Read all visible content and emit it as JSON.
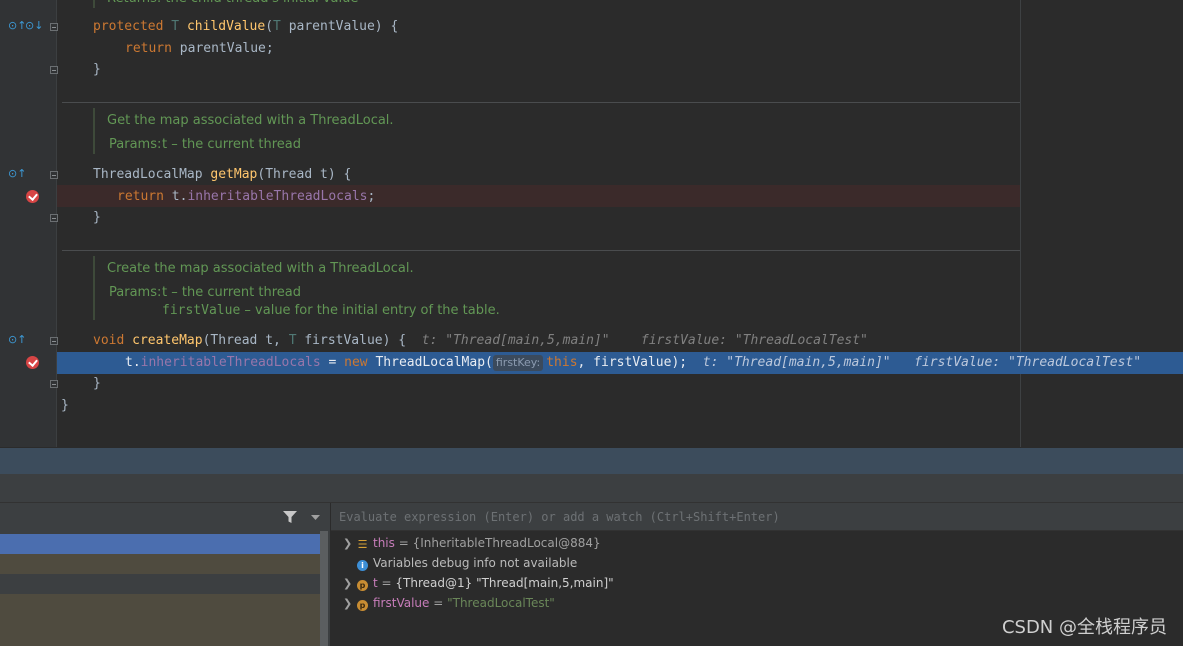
{
  "editor": {
    "line_prev_doc": "Returns: the child thread's initial value",
    "child_value_sig": {
      "kw": "protected",
      "tp1": "T",
      "name": "childValue",
      "rest": "(",
      "tp2": "T",
      "param": " parentValue) {"
    },
    "child_value_body": {
      "kw": "return",
      "rest": " parentValue;"
    },
    "close_brace": "}",
    "getmap_doc_line1": "Get the map associated with a ThreadLocal.",
    "getmap_doc_params": "Params:",
    "getmap_doc_param_t": "t – the current thread",
    "getmap_sig": {
      "type": "ThreadLocalMap ",
      "name": "getMap",
      "rest": "(Thread t) {"
    },
    "getmap_body": {
      "kw": "return",
      "obj": " t.",
      "field": "inheritableThreadLocals",
      "end": ";"
    },
    "createmap_doc_line1": "Create the map associated with a ThreadLocal.",
    "createmap_doc_params": "Params:",
    "createmap_doc_param_t": "t – the current thread",
    "createmap_doc_param_fv_name": "firstValue",
    "createmap_doc_param_fv_desc": " – value for the initial entry of the table.",
    "createmap_sig": {
      "kw": "void",
      "name": "createMap",
      "rest1": "(Thread t, ",
      "tp": "T",
      "rest2": " firstValue) {",
      "hint1": "t: \"Thread[main,5,main]\"",
      "hint2": "firstValue: \"ThreadLocalTest\""
    },
    "createmap_body": {
      "obj": "t.",
      "field": "inheritableThreadLocals",
      "assign": " = ",
      "kw_new": "new",
      "cls": " ThreadLocalMap(",
      "inlay": "firstKey:",
      "kw_this": "this",
      "rest": ", firstValue);",
      "hint1": "t: \"Thread[main,5,main]\"",
      "hint2": "firstValue: \"ThreadLocalTest\""
    },
    "class_close": "}"
  },
  "debugger": {
    "eval_placeholder": "Evaluate expression (Enter) or add a watch (Ctrl+Shift+Enter)",
    "variables": [
      {
        "name": "this",
        "value": "{InheritableThreadLocal@884}",
        "icon": "list-icon",
        "expandable": true
      },
      {
        "name": "",
        "value": "Variables debug info not available",
        "icon": "info-icon",
        "expandable": false
      },
      {
        "name": "t",
        "value": "{Thread@1} \"Thread[main,5,main]\"",
        "icon": "param-icon",
        "expandable": true
      },
      {
        "name": "firstValue",
        "value": "\"ThreadLocalTest\"",
        "icon": "param-icon",
        "expandable": true
      }
    ]
  },
  "watermark": "CSDN @全栈程序员",
  "colors": {
    "exec_line": "#2d5b93",
    "breakpoint": "#d64545",
    "doc_comment": "#629755"
  }
}
